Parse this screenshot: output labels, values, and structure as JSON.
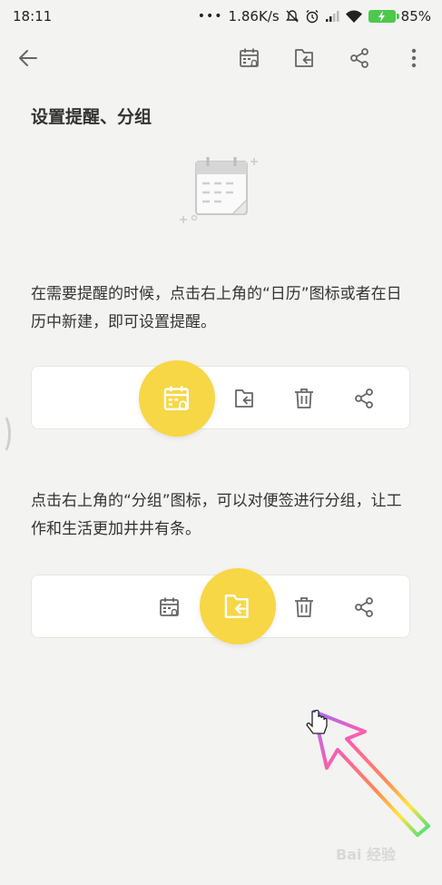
{
  "status_bar": {
    "time": "18:11",
    "network_speed": "1.86K/s",
    "battery_percent": "85%",
    "icons": [
      "dots-icon",
      "mute-bell-icon",
      "alarm-icon",
      "signal-icon",
      "wifi-icon",
      "battery-charging-icon"
    ]
  },
  "toolbar": {
    "icons": [
      "back-arrow-icon",
      "calendar-reminder-icon",
      "move-to-folder-icon",
      "share-icon",
      "more-vertical-icon"
    ]
  },
  "content": {
    "title": "设置提醒、分组",
    "paragraph1": "在需要提醒的时候，点击右上角的“日历”图标或者在日历中新建，即可设置提醒。",
    "paragraph2": "点击右上角的“分组”图标，可以对便签进行分组，让工作和生活更加井井有条。"
  },
  "card1": {
    "highlighted": "calendar-reminder-icon",
    "icons": [
      "calendar-reminder-icon",
      "move-to-folder-icon",
      "trash-icon",
      "share-icon"
    ]
  },
  "card2": {
    "highlighted": "move-to-folder-icon",
    "icons": [
      "calendar-reminder-icon",
      "move-to-folder-icon",
      "trash-icon",
      "share-icon"
    ]
  },
  "watermark": "Bai 经验",
  "colors": {
    "highlight": "#f7d745",
    "background": "#f3f3f1",
    "icon": "#666666"
  }
}
